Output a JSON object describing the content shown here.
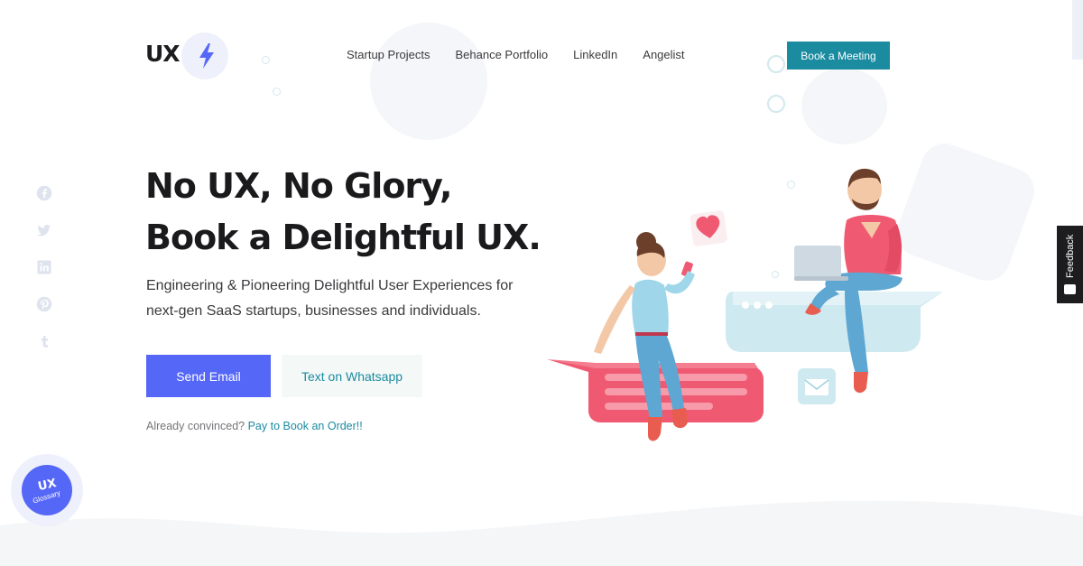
{
  "logo": {
    "text": "UX"
  },
  "nav": {
    "items": [
      "Startup Projects",
      "Behance Portfolio",
      "LinkedIn",
      "Angelist"
    ],
    "cta": "Book a Meeting"
  },
  "social": {
    "icons": [
      "facebook-icon",
      "twitter-icon",
      "linkedin-icon",
      "pinterest-icon",
      "tumblr-icon"
    ],
    "color": "#dfe3ee"
  },
  "hero": {
    "title_line1": "No UX, No Glory,",
    "title_line2": "Book a Delightful UX.",
    "subtitle_line1": "Engineering & Pioneering Delightful User Experiences for",
    "subtitle_line2": "next-gen SaaS startups, businesses and individuals.",
    "primary_button": "Send Email",
    "secondary_button": "Text on Whatsapp",
    "convinced_text": "Already convinced?",
    "convinced_link": "Pay to Book an Order!!"
  },
  "glossary": {
    "logo": "UX",
    "label": "Glossary"
  },
  "feedback": {
    "label": "Feedback"
  },
  "colors": {
    "primary": "#5567f6",
    "teal": "#1b8ba0",
    "heading": "#1a1a1c",
    "muted": "#76767a"
  }
}
